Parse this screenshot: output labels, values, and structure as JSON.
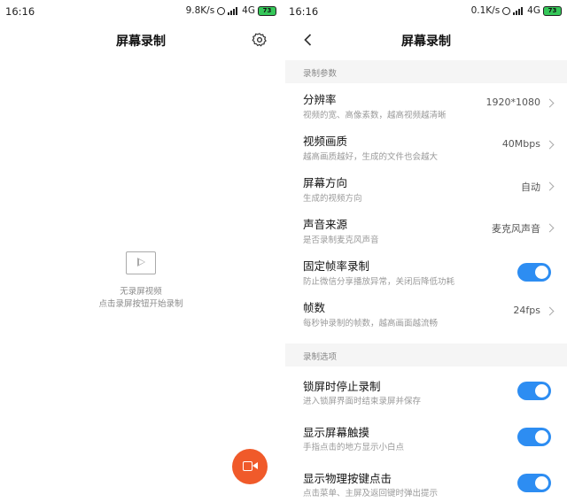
{
  "left": {
    "status": {
      "time": "16:16",
      "speed": "9.8K/s",
      "network": "4G",
      "battery": "73"
    },
    "title": "屏幕录制",
    "empty": {
      "line1": "无录屏视频",
      "line2": "点击录屏按钮开始录制"
    }
  },
  "right": {
    "status": {
      "time": "16:16",
      "speed": "0.1K/s",
      "network": "4G",
      "battery": "73"
    },
    "title": "屏幕录制",
    "section1": "录制参数",
    "section2": "录制选项",
    "rows": [
      {
        "title": "分辨率",
        "sub": "视频的宽、高像素数，越高视频越清晰",
        "value": "1920*1080"
      },
      {
        "title": "视频画质",
        "sub": "越高画质越好，生成的文件也会越大",
        "value": "40Mbps"
      },
      {
        "title": "屏幕方向",
        "sub": "生成的视频方向",
        "value": "自动"
      },
      {
        "title": "声音来源",
        "sub": "是否录制麦克风声音",
        "value": "麦克风声音"
      },
      {
        "title": "固定帧率录制",
        "sub": "防止微信分享播放异常，关闭后降低功耗",
        "toggle": true
      },
      {
        "title": "帧数",
        "sub": "每秒钟录制的帧数，越高画面越流畅",
        "value": "24fps"
      }
    ],
    "options": [
      {
        "title": "锁屏时停止录制",
        "sub": "进入锁屏界面时结束录屏并保存",
        "toggle": true
      },
      {
        "title": "显示屏幕触摸",
        "sub": "手指点击的地方显示小白点",
        "toggle": true
      },
      {
        "title": "显示物理按键点击",
        "sub": "点击菜单、主屏及返回键时弹出提示",
        "toggle": true
      }
    ]
  },
  "colors": {
    "accent": "#2d8df2",
    "fab": "#f05a2a",
    "battery": "#35c759"
  }
}
